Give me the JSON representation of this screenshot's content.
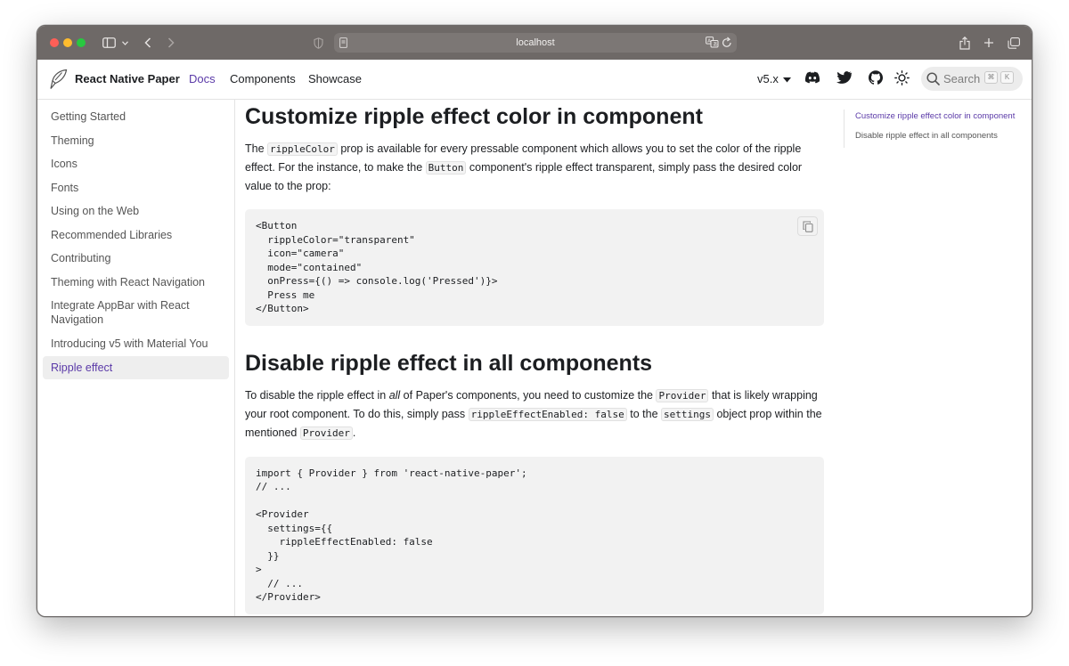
{
  "browser": {
    "address": "localhost"
  },
  "navbar": {
    "brand": "React Native Paper",
    "links": [
      "Docs",
      "Components",
      "Showcase"
    ],
    "version": "v5.x",
    "search_placeholder": "Search",
    "search_keys": [
      "⌘",
      "K"
    ]
  },
  "sidebar": {
    "items": [
      "Getting Started",
      "Theming",
      "Icons",
      "Fonts",
      "Using on the Web",
      "Recommended Libraries",
      "Contributing",
      "Theming with React Navigation",
      "Integrate AppBar with React Navigation",
      "Introducing v5 with Material You",
      "Ripple effect"
    ]
  },
  "content": {
    "section1": {
      "title": "Customize ripple effect color in component",
      "p1_a": "The ",
      "p1_code1": "rippleColor",
      "p1_b": " prop is available for every pressable component which allows you to set the color of the ripple effect. For the instance, to make the ",
      "p1_code2": "Button",
      "p1_c": " component's ripple effect transparent, simply pass the desired color value to the prop:",
      "code": "<Button\n  rippleColor=\"transparent\"\n  icon=\"camera\"\n  mode=\"contained\"\n  onPress={() => console.log('Pressed')}>\n  Press me\n</Button>"
    },
    "section2": {
      "title": "Disable ripple effect in all components",
      "p_a": "To disable the ripple effect in ",
      "p_em": "all",
      "p_b": " of Paper's components, you need to customize the ",
      "p_code1": "Provider",
      "p_c": " that is likely wrapping your root component. To do this, simply pass ",
      "p_code2": "rippleEffectEnabled: false",
      "p_d": " to the ",
      "p_code3": "settings",
      "p_e": " object prop within the mentioned ",
      "p_code4": "Provider",
      "p_f": ".",
      "code": "import { Provider } from 'react-native-paper';\n// ...\n\n<Provider\n  settings={{\n    rippleEffectEnabled: false\n  }}\n>\n  // ...\n</Provider>"
    }
  },
  "toc": {
    "items": [
      "Customize ripple effect color in component",
      "Disable ripple effect in all components"
    ]
  },
  "colors": {
    "accent": "#5b3aa8"
  }
}
